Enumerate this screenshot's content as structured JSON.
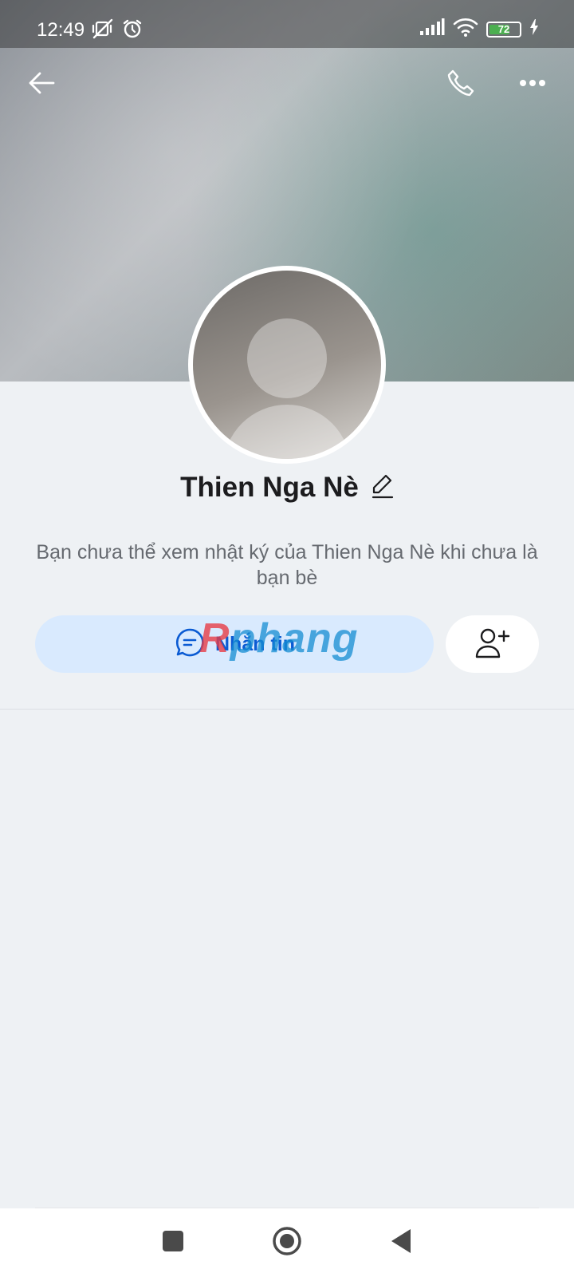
{
  "status_bar": {
    "time": "12:49",
    "battery": "72",
    "battery_level": 0.72,
    "icons_left": [
      "vibrate-off-icon",
      "alarm-icon"
    ],
    "icons_right": [
      "signal-icon",
      "wifi-icon",
      "battery-icon",
      "charging-icon"
    ]
  },
  "topbar": {
    "icons": [
      "back-arrow-icon",
      "phone-icon",
      "more-icon"
    ]
  },
  "profile": {
    "name": "Thien Nga Nè",
    "edit_icon": "pencil-icon",
    "notice": "Bạn chưa thể xem nhật ký của Thien Nga Nè khi chưa là bạn bè"
  },
  "actions": {
    "message_label": "Nhắn tin",
    "message_icon": "chat-bubble-icon",
    "add_friend_icon": "add-friend-icon"
  },
  "watermark": {
    "prefix": "R",
    "rest": "phang"
  },
  "colors": {
    "accent": "#0b5bd3",
    "message_button_bg": "#d9eafe",
    "page_bg": "#eef1f4"
  },
  "nav_bar": {
    "icons": [
      "recent-apps-icon",
      "home-icon",
      "back-icon"
    ]
  }
}
